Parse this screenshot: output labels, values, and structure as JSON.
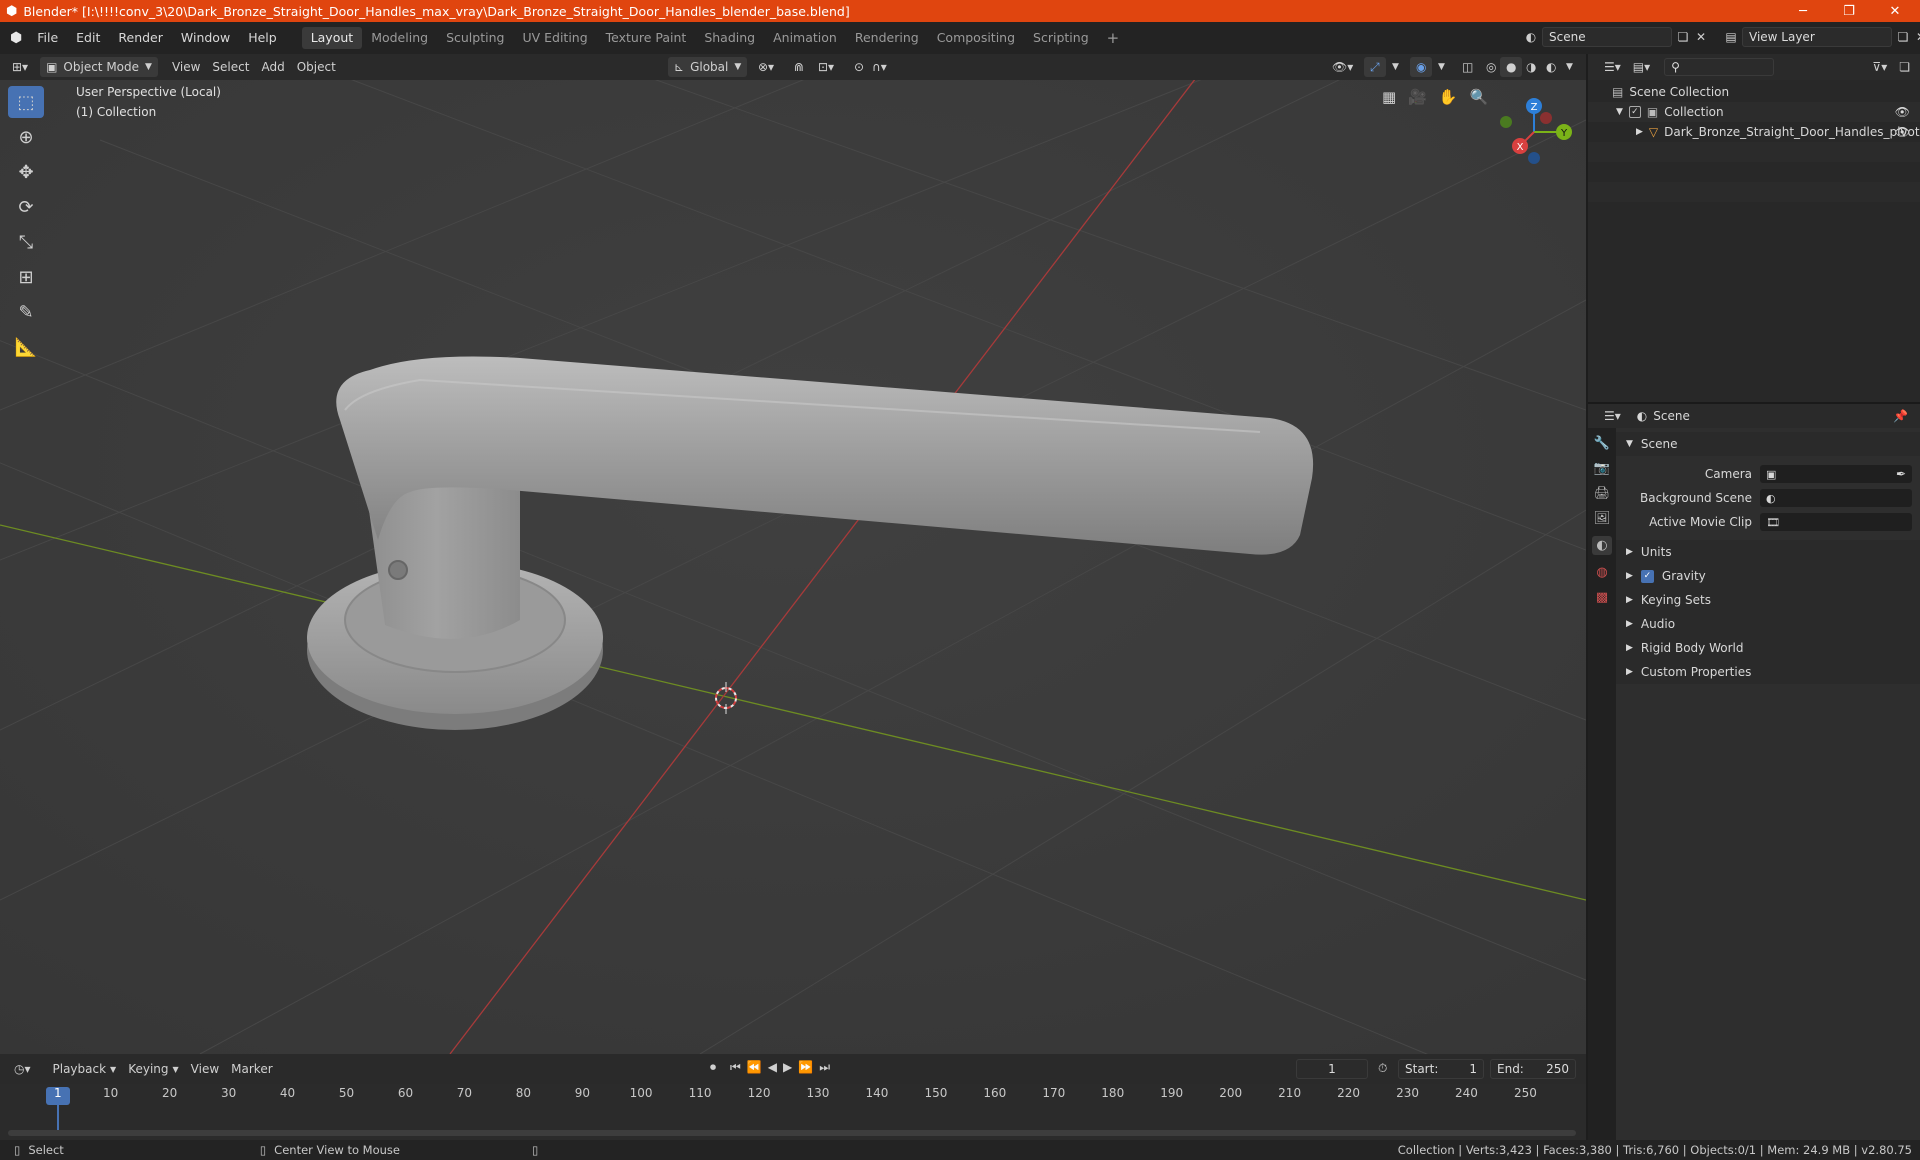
{
  "window": {
    "title": "Blender* [I:\\!!!!conv_3\\20\\Dark_Bronze_Straight_Door_Handles_max_vray\\Dark_Bronze_Straight_Door_Handles_blender_base.blend]",
    "minimize": "─",
    "restore": "❐",
    "close": "✕"
  },
  "menu": {
    "items": [
      "File",
      "Edit",
      "Render",
      "Window",
      "Help"
    ],
    "workspaces": [
      "Layout",
      "Modeling",
      "Sculpting",
      "UV Editing",
      "Texture Paint",
      "Shading",
      "Animation",
      "Rendering",
      "Compositing",
      "Scripting"
    ],
    "add_tab": "+",
    "scene_name": "Scene",
    "view_layer": "View Layer"
  },
  "viewport_header": {
    "mode": "Object Mode",
    "menus": [
      "View",
      "Select",
      "Add",
      "Object"
    ],
    "transform_orientation": "Global"
  },
  "viewport": {
    "perspective_label": "User Perspective (Local)",
    "collection_label": "(1) Collection",
    "gizmo_axes": {
      "x": "X",
      "y": "Y",
      "z": "Z"
    }
  },
  "outliner": {
    "rows": [
      {
        "label": "Scene Collection"
      },
      {
        "label": "Collection"
      },
      {
        "label": "Dark_Bronze_Straight_Door_Handles_pivot"
      }
    ]
  },
  "properties": {
    "context": "Scene",
    "panel": "Scene",
    "fields": [
      {
        "label": "Camera",
        "value": ""
      },
      {
        "label": "Background Scene",
        "value": ""
      },
      {
        "label": "Active Movie Clip",
        "value": ""
      }
    ],
    "sections": [
      "Units",
      "Gravity",
      "Keying Sets",
      "Audio",
      "Rigid Body World",
      "Custom Properties"
    ]
  },
  "timeline": {
    "menus": [
      "Playback",
      "Keying",
      "View",
      "Marker"
    ],
    "current_frame": "1",
    "start_label": "Start:",
    "start": "1",
    "end_label": "End:",
    "end": "250",
    "ticks": [
      "1",
      "10",
      "20",
      "30",
      "40",
      "50",
      "60",
      "70",
      "80",
      "90",
      "100",
      "110",
      "120",
      "130",
      "140",
      "150",
      "160",
      "170",
      "180",
      "190",
      "200",
      "210",
      "220",
      "230",
      "240",
      "250"
    ]
  },
  "status": {
    "left": "Select",
    "middle": "Center View to Mouse",
    "right": "Collection | Verts:3,423 | Faces:3,380 | Tris:6,760 | Objects:0/1 | Mem: 24.9 MB | v2.80.75"
  },
  "colors": {
    "title_bar": "#e0450f",
    "accent": "#4772b3",
    "x_axis": "#d8403f",
    "y_axis": "#7bb318",
    "z_axis": "#2d7fd8"
  }
}
